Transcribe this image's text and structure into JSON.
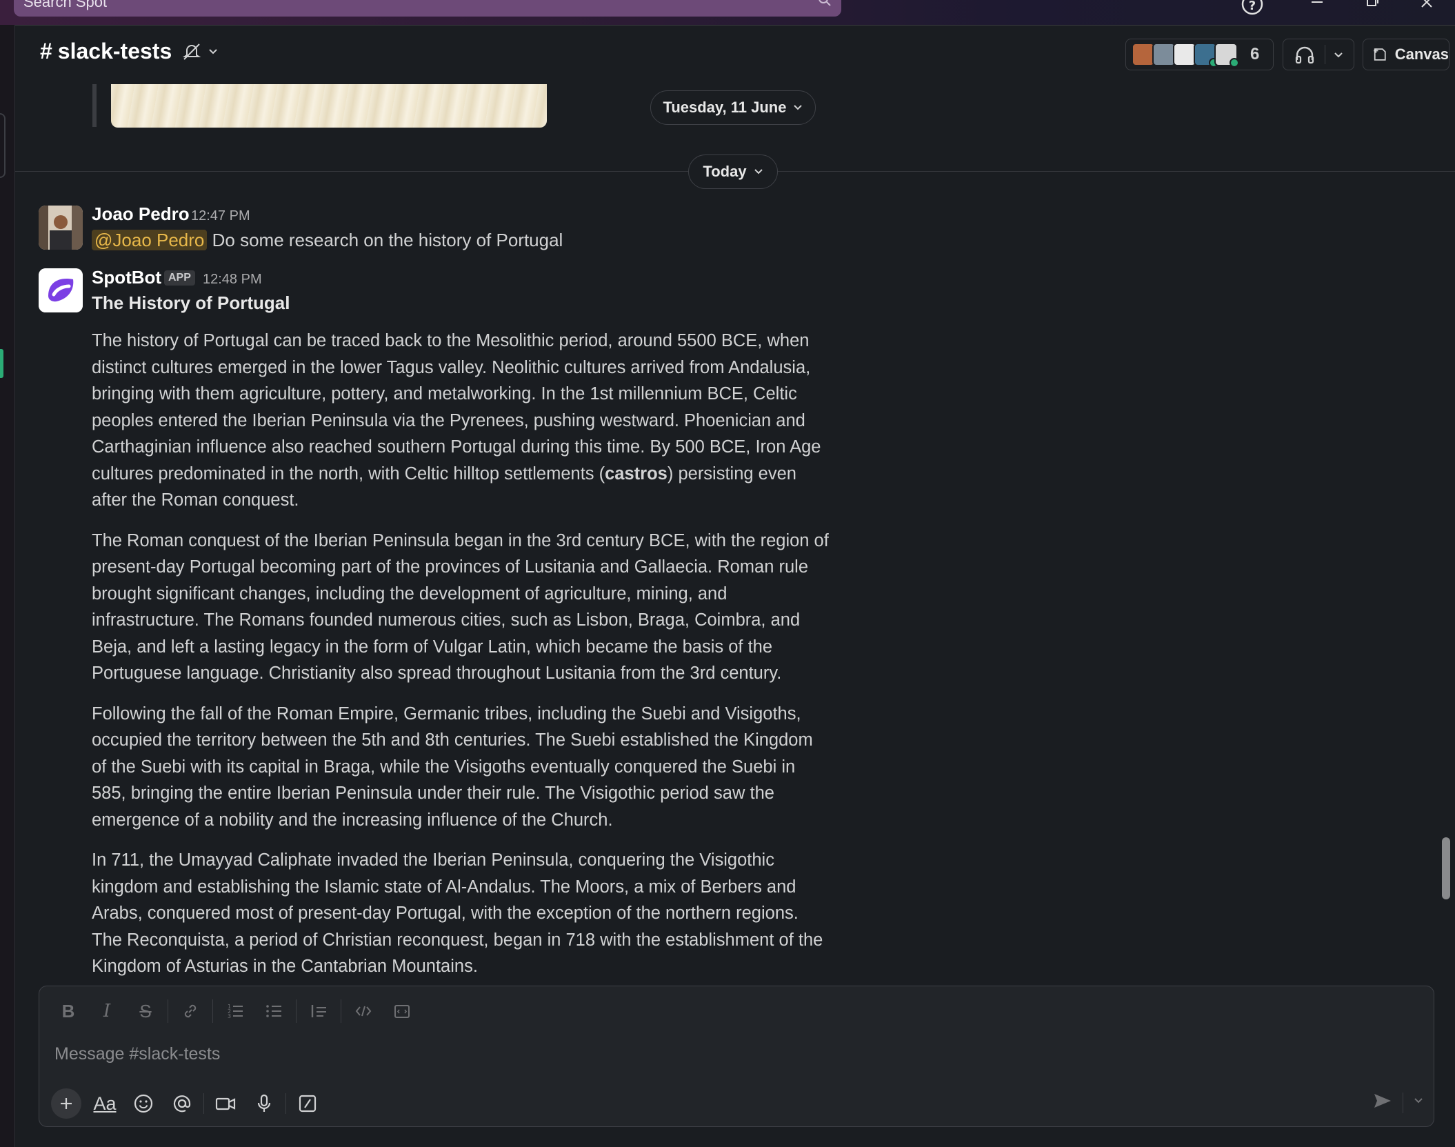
{
  "search": {
    "placeholder": "Search Spot"
  },
  "channel": {
    "name": "slack-tests",
    "hash": "#"
  },
  "header": {
    "member_count": "6",
    "canvas_label": "Canvas"
  },
  "date_dividers": {
    "previous": "Tuesday, 11 June",
    "today": "Today"
  },
  "messages": [
    {
      "sender": "Joao Pedro",
      "time": "12:47 PM",
      "mention": "@Joao Pedro",
      "text": "Do some research on the history of Portugal"
    },
    {
      "sender": "SpotBot",
      "badge": "APP",
      "time": "12:48 PM",
      "heading": "The History of Portugal",
      "paragraphs": [
        "The history of Portugal can be traced back to the Mesolithic period, around 5500 BCE, when distinct cultures emerged in the lower Tagus valley. Neolithic cultures arrived from Andalusia, bringing with them agriculture, pottery, and metalworking. In the 1st millennium BCE, Celtic peoples entered the Iberian Peninsula via the Pyrenees, pushing westward. Phoenician and Carthaginian influence also reached southern Portugal during this time. By 500 BCE, Iron Age cultures predominated in the north, with Celtic hilltop settlements",
        "The Roman conquest of the Iberian Peninsula began in the 3rd century BCE, with the region of present-day Portugal becoming part of the provinces of Lusitania and Gallaecia. Roman rule brought significant changes, including the development of agriculture, mining, and infrastructure. The Romans founded numerous cities, such as Lisbon, Braga, Coimbra, and Beja, and left a lasting legacy in the form of Vulgar Latin, which became the basis of the Portuguese language. Christianity also spread throughout Lusitania from the 3rd century.",
        "Following the fall of the Roman Empire, Germanic tribes, including the Suebi and Visigoths, occupied the territory between the 5th and 8th centuries. The Suebi established the Kingdom of the Suebi with its capital in Braga, while the Visigoths eventually conquered the Suebi in 585, bringing the entire Iberian Peninsula under their rule. The Visigothic period saw the emergence of a nobility and the increasing influence of the Church.",
        "In 711, the Umayyad Caliphate invaded the Iberian Peninsula, conquering the Visigothic kingdom and establishing the Islamic state of Al-Andalus. The Moors, a mix of Berbers and Arabs, conquered most of present-day Portugal, with the exception of the northern regions. The Reconquista, a period of Christian reconquest, began in 718 with the establishment of the Kingdom of Asturias in the Cantabrian Mountains."
      ],
      "p1_bold": "castros",
      "p1_tail": "persisting even after the Roman conquest.",
      "p1_open": "(",
      "p1_close": ")"
    }
  ],
  "composer": {
    "placeholder": "Message #slack-tests"
  },
  "colors": {
    "accent_green": "#2bac76",
    "mention_bg": "#4d3f1f",
    "mention_fg": "#e8b84a",
    "bot_purple": "#7b3fe4"
  }
}
